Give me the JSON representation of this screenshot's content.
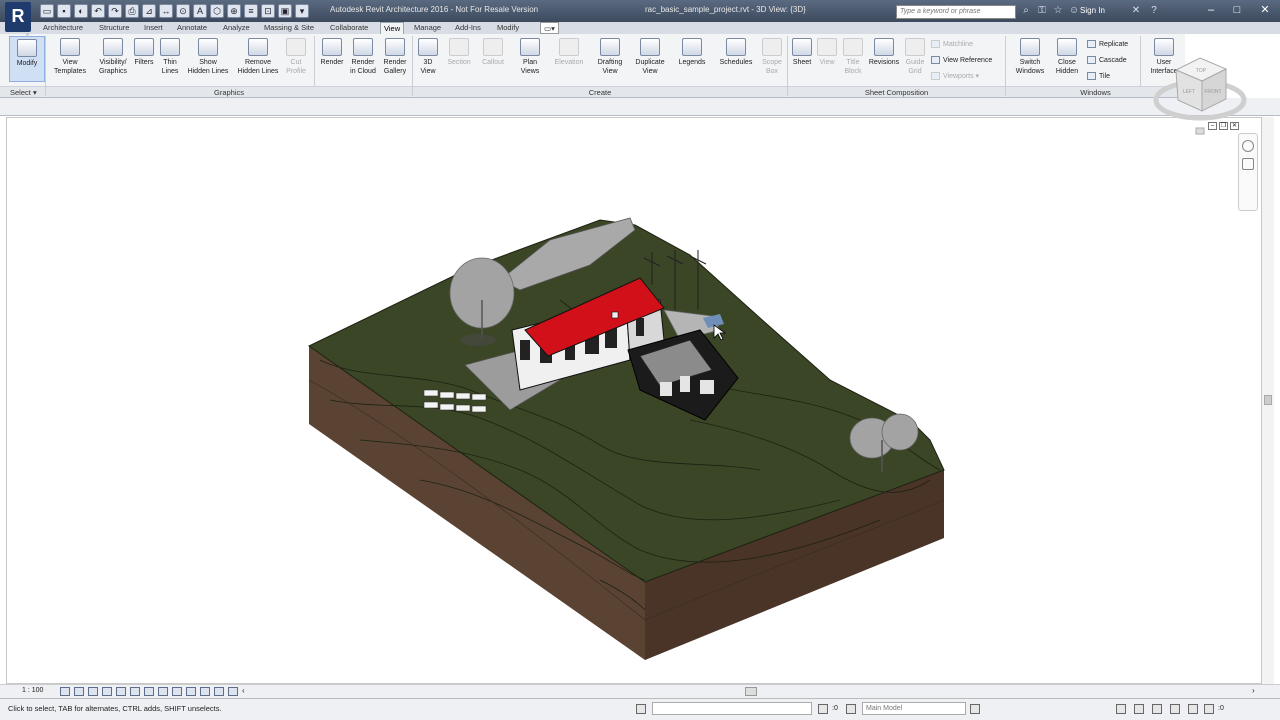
{
  "titlebar": {
    "app_logo": "R",
    "app_title": "Autodesk Revit Architecture 2016 - Not For Resale Version",
    "file_title": "rac_basic_sample_project.rvt - 3D View: {3D}",
    "search_placeholder": "Type a keyword or phrase",
    "sign_in": "Sign In"
  },
  "tabs": [
    "Architecture",
    "Structure",
    "Insert",
    "Annotate",
    "Analyze",
    "Massing & Site",
    "Collaborate",
    "View",
    "Manage",
    "Add-Ins",
    "Modify"
  ],
  "active_tab": "View",
  "ribbon": {
    "modify": "Modify",
    "select": "Select",
    "graphics": {
      "label": "Graphics",
      "view_templates": [
        "View",
        "Templates"
      ],
      "visibility": [
        "Visibility/",
        "Graphics"
      ],
      "filters": "Filters",
      "thin_lines": [
        "Thin",
        "Lines"
      ],
      "show_hidden": [
        "Show",
        "Hidden Lines"
      ],
      "remove_hidden": [
        "Remove",
        "Hidden Lines"
      ],
      "cut_profile": [
        "Cut",
        "Profile"
      ],
      "render": "Render",
      "render_cloud": [
        "Render",
        "in Cloud"
      ],
      "render_gallery": [
        "Render",
        "Gallery"
      ]
    },
    "create": {
      "label": "Create",
      "view_3d": [
        "3D",
        "View"
      ],
      "section": "Section",
      "callout": "Callout",
      "plan_views": [
        "Plan",
        "Views"
      ],
      "elevation": "Elevation",
      "drafting_view": [
        "Drafting",
        "View"
      ],
      "duplicate_view": [
        "Duplicate",
        "View"
      ],
      "legends": "Legends",
      "schedules": "Schedules",
      "scope_box": [
        "Scope",
        "Box"
      ]
    },
    "sheet_composition": {
      "label": "Sheet Composition",
      "sheet": "Sheet",
      "view": "View",
      "title_block": [
        "Title",
        "Block"
      ],
      "revisions": "Revisions",
      "guide_grid": [
        "Guide",
        "Grid"
      ],
      "matchline": "Matchline",
      "view_reference": "View Reference",
      "viewports": "Viewports"
    },
    "windows": {
      "label": "Windows",
      "switch_windows": [
        "Switch",
        "Windows"
      ],
      "close_hidden": [
        "Close",
        "Hidden"
      ],
      "replicate": "Replicate",
      "cascade": "Cascade",
      "tile": "Tile"
    },
    "user_interface": [
      "User",
      "Interface"
    ]
  },
  "viewcube": {
    "top": "TOP",
    "front": "FRONT",
    "left": "LEFT"
  },
  "viewbar": {
    "scale": "1 : 100"
  },
  "statusbar": {
    "text": "Click to select, TAB for alternates, CTRL adds, SHIFT unselects.",
    "sel_count": ":0",
    "model": "Main Model",
    "filter_count": ":0"
  },
  "colors": {
    "roof": "#d2101a",
    "terrain_top": "#3a4625",
    "terrain_front": "#5a4332",
    "terrain_side": "#4a3427"
  }
}
